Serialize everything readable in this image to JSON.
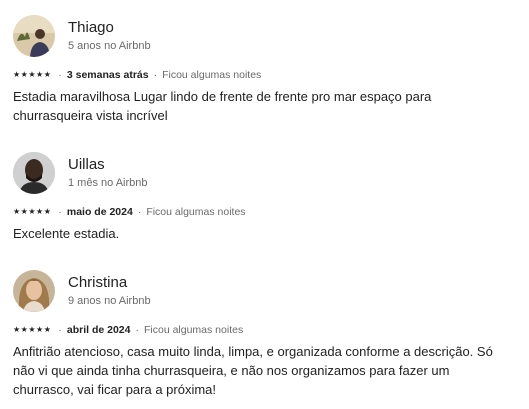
{
  "reviews": [
    {
      "name": "Thiago",
      "tenure": "5 anos no Airbnb",
      "rating": 5,
      "stars": "★★★★★",
      "date": "3 semanas atrás",
      "stay": "Ficou algumas noites",
      "text": "Estadia maravilhosa Lugar lindo de frente de frente pro mar espaço para churrasqueira vista incrível"
    },
    {
      "name": "Uillas",
      "tenure": "1 mês no Airbnb",
      "rating": 5,
      "stars": "★★★★★",
      "date": "maio de 2024",
      "stay": "Ficou algumas noites",
      "text": "Excelente estadia."
    },
    {
      "name": "Christina",
      "tenure": "9 anos no Airbnb",
      "rating": 5,
      "stars": "★★★★★",
      "date": "abril de 2024",
      "stay": "Ficou algumas noites",
      "text": "Anfitrião atencioso, casa muito linda, limpa, e organizada conforme a descrição. Só não vi que ainda tinha churrasqueira, e não nos organizamos para fazer um churrasco, vai ficar para a próxima!"
    }
  ],
  "separator": "·"
}
